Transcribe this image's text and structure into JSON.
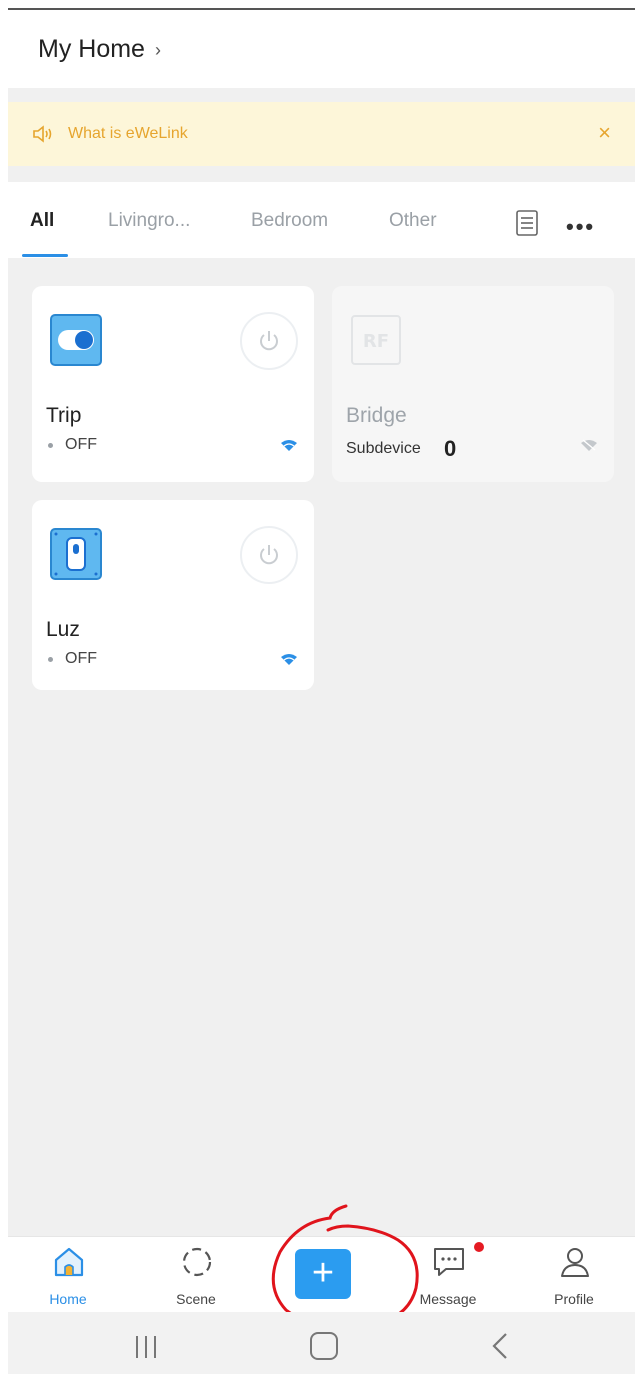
{
  "header": {
    "title": "My Home",
    "chevron": "›"
  },
  "banner": {
    "text": "What is eWeLink",
    "close": "×",
    "icon": "speaker-icon",
    "color": "#e6a52e"
  },
  "tabs": {
    "items": [
      {
        "label": "All",
        "active": true
      },
      {
        "label": "Livingro..."
      },
      {
        "label": "Bedroom"
      },
      {
        "label": "Other"
      }
    ],
    "more": "•••"
  },
  "devices": [
    {
      "name": "Trip",
      "status": "OFF",
      "icon": "toggle-switch-icon"
    },
    {
      "name": "Bridge",
      "sub_label": "Subdevice",
      "sub_count": "0",
      "icon": "rf-icon",
      "offline": true
    },
    {
      "name": "Luz",
      "status": "OFF",
      "icon": "wall-switch-icon"
    }
  ],
  "tabbar": {
    "items": [
      {
        "label": "Home",
        "active": true
      },
      {
        "label": "Scene"
      },
      {
        "label": "Message"
      },
      {
        "label": "Profile"
      }
    ],
    "add": "+"
  },
  "colors": {
    "accent": "#2b9cf0",
    "active_tab": "#2b8fe6",
    "badge": "#e51b23",
    "annotation": "#e0141c"
  }
}
